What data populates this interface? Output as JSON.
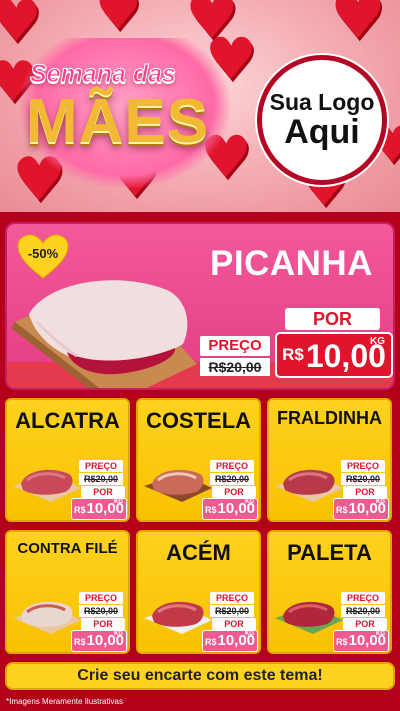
{
  "header": {
    "title_line1": "Semana das",
    "title_line2": "MÃES",
    "logo_line1": "Sua Logo",
    "logo_line2": "Aqui"
  },
  "featured": {
    "name": "PICANHA",
    "discount": "-50%",
    "preco_label": "PREÇO",
    "old_price": "R$20,00",
    "por_label": "POR",
    "currency": "R$",
    "new_price": "10,00",
    "unit": "KG"
  },
  "products": [
    {
      "name": "ALCATRA",
      "preco_label": "PREÇO",
      "old_price": "R$20,00",
      "por_label": "POR",
      "currency": "R$",
      "new_price": "10,00",
      "unit": "KG"
    },
    {
      "name": "COSTELA",
      "preco_label": "PREÇO",
      "old_price": "R$20,00",
      "por_label": "POR",
      "currency": "R$",
      "new_price": "10,00",
      "unit": "KG"
    },
    {
      "name": "FRALDINHA",
      "preco_label": "PREÇO",
      "old_price": "R$20,00",
      "por_label": "POR",
      "currency": "R$",
      "new_price": "10,00",
      "unit": "KG"
    },
    {
      "name": "CONTRA FILÉ",
      "preco_label": "PREÇO",
      "old_price": "R$20,00",
      "por_label": "POR",
      "currency": "R$",
      "new_price": "10,00",
      "unit": "KG"
    },
    {
      "name": "ACÉM",
      "preco_label": "PREÇO",
      "old_price": "R$20,00",
      "por_label": "POR",
      "currency": "R$",
      "new_price": "10,00",
      "unit": "KG"
    },
    {
      "name": "PALETA",
      "preco_label": "PREÇO",
      "old_price": "R$20,00",
      "por_label": "POR",
      "currency": "R$",
      "new_price": "10,00",
      "unit": "KG"
    }
  ],
  "cta": "Crie seu encarte com este tema!",
  "disclaimer": "*Imagens Meramente Ilustrativas",
  "colors": {
    "background": "#b3001b",
    "featured_pink": "#e43e83",
    "card_yellow": "#ffd21f",
    "price_red": "#e0142b"
  }
}
